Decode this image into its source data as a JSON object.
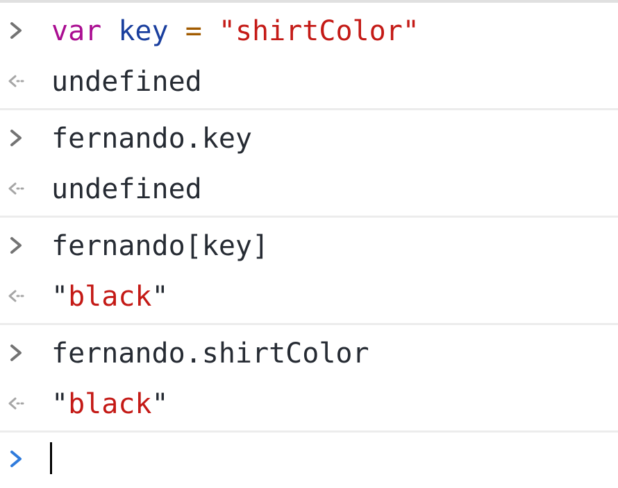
{
  "console": {
    "entries": [
      {
        "input": {
          "keyword": "var",
          "identifier": "key",
          "operator": "=",
          "string": "\"shirtColor\""
        },
        "output": {
          "text": "undefined",
          "kind": "undefined"
        }
      },
      {
        "input": {
          "text": "fernando.key"
        },
        "output": {
          "text": "undefined",
          "kind": "undefined"
        }
      },
      {
        "input": {
          "text": "fernando[key]"
        },
        "output": {
          "quote_open": "\"",
          "value": "black",
          "quote_close": "\"",
          "kind": "string"
        }
      },
      {
        "input": {
          "text": "fernando.shirtColor"
        },
        "output": {
          "quote_open": "\"",
          "value": "black",
          "quote_close": "\"",
          "kind": "string"
        }
      }
    ],
    "prompt": {
      "value": ""
    }
  },
  "icons": {
    "input_arrow": "chevron-right-icon",
    "output_arrow": "return-arrow-icon",
    "prompt_arrow": "chevron-right-icon"
  },
  "colors": {
    "keyword": "#aa0d91",
    "identifier": "#1a3f9e",
    "operator": "#a15b00",
    "string": "#c41a16",
    "text": "#262b33",
    "undefined": "#808080",
    "input_arrow": "#737373",
    "output_arrow": "#a6a6a6",
    "prompt_arrow": "#2f7bdc"
  }
}
